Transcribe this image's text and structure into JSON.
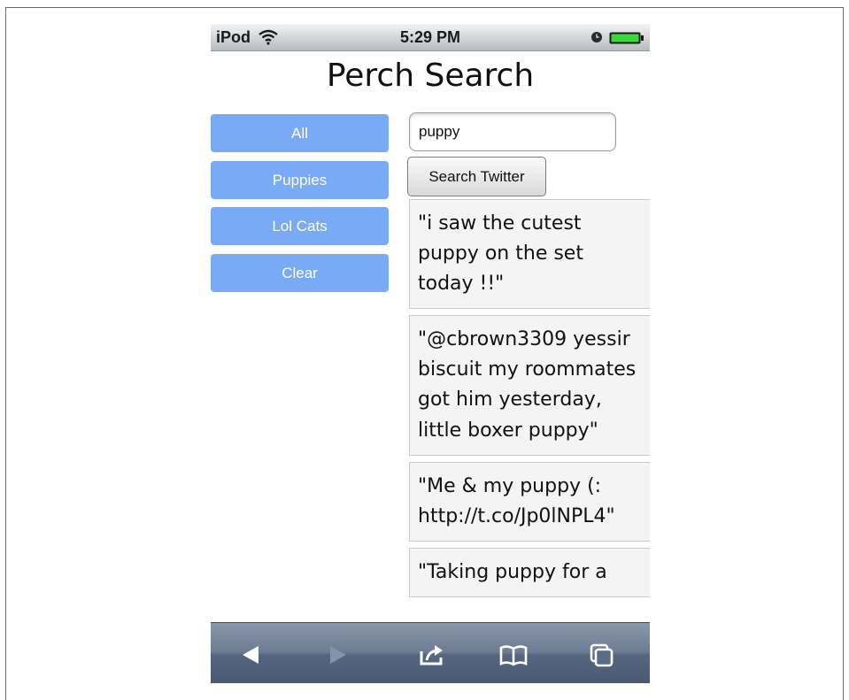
{
  "status_bar": {
    "carrier": "iPod",
    "time": "5:29 PM"
  },
  "page": {
    "title": "Perch Search"
  },
  "filters": [
    {
      "label": "All"
    },
    {
      "label": "Puppies"
    },
    {
      "label": "Lol Cats"
    },
    {
      "label": "Clear"
    }
  ],
  "search": {
    "value": "puppy",
    "button_label": "Search Twitter"
  },
  "tweets": [
    {
      "text": "\"i saw the cutest puppy on the set today !!\""
    },
    {
      "text": "\"@cbrown3309 yessir biscuit my roommates got him yesterday, little boxer puppy\""
    },
    {
      "text": "\"Me & my puppy (: http://t.co/Jp0lNPL4\""
    },
    {
      "text": "\"Taking puppy for a"
    }
  ],
  "toolbar": {
    "icons": [
      "back-icon",
      "forward-icon",
      "share-icon",
      "bookmarks-icon",
      "pages-icon"
    ]
  },
  "colors": {
    "filter_button": "#79aaf5",
    "toolbar": "#5b6b85",
    "tweet_bg": "#f4f4f4"
  }
}
